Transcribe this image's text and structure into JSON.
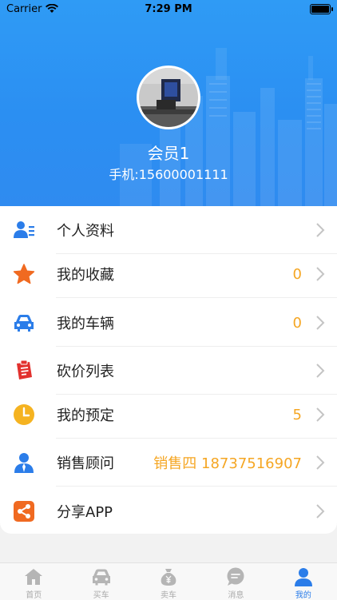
{
  "status_bar": {
    "carrier": "Carrier",
    "time": "7:29 PM"
  },
  "profile": {
    "name": "会员1",
    "phone": "手机:15600001111"
  },
  "menu": {
    "items": [
      {
        "label": "个人资料",
        "value": "",
        "icon": "profile-card-icon"
      },
      {
        "label": "我的收藏",
        "value": "0",
        "icon": "star-icon"
      },
      {
        "label": "我的车辆",
        "value": "0",
        "icon": "car-icon"
      },
      {
        "label": "砍价列表",
        "value": "",
        "icon": "price-list-icon"
      },
      {
        "label": "我的预定",
        "value": "5",
        "icon": "clock-icon"
      },
      {
        "label": "销售顾问",
        "value": "销售四 18737516907",
        "icon": "advisor-icon"
      },
      {
        "label": "分享APP",
        "value": "",
        "icon": "share-icon"
      }
    ]
  },
  "tabbar": {
    "tabs": [
      {
        "label": "首页",
        "icon": "home-icon",
        "active": false
      },
      {
        "label": "买车",
        "icon": "car-icon",
        "active": false
      },
      {
        "label": "卖车",
        "icon": "yen-bag-icon",
        "active": false
      },
      {
        "label": "消息",
        "icon": "message-icon",
        "active": false
      },
      {
        "label": "我的",
        "icon": "user-icon",
        "active": true
      }
    ]
  },
  "colors": {
    "header_blue": "#2b8ff2",
    "accent_orange": "#f5a623",
    "active_tab": "#2b7de9"
  }
}
